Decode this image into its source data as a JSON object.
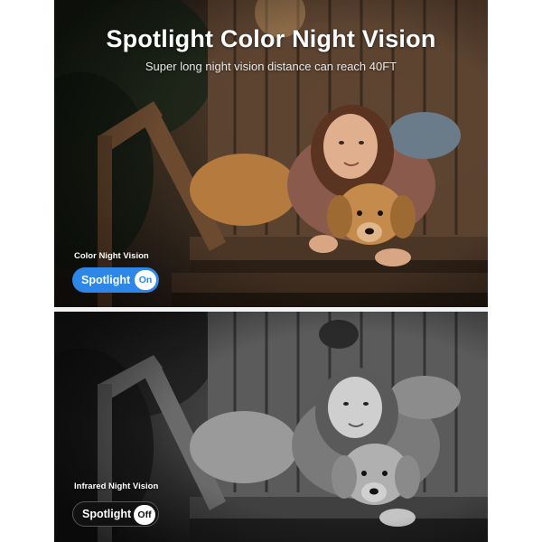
{
  "headline": {
    "title": "Spotlight Color Night Vision",
    "subtitle": "Super long night vision distance can reach 40FT"
  },
  "color_panel": {
    "mode_label": "Color Night Vision",
    "toggle_label": "Spotlight",
    "toggle_state": "On"
  },
  "infrared_panel": {
    "mode_label": "Infrared Night Vision",
    "toggle_label": "Spotlight",
    "toggle_state": "Off"
  },
  "colors": {
    "toggle_on": "#2e86e8",
    "toggle_off": "#111111"
  }
}
